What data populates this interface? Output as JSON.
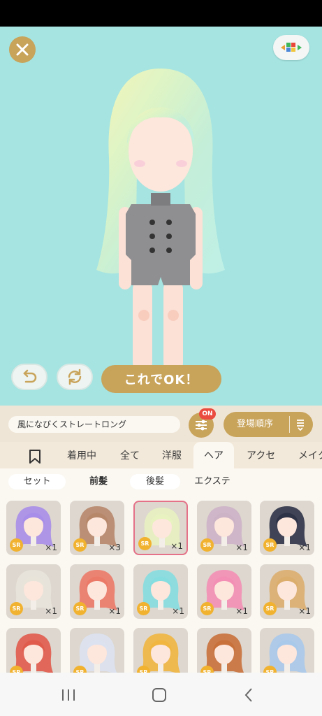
{
  "preview": {
    "ok_label": "これでOK！"
  },
  "controls": {
    "item_name": "風になびくストレートロング",
    "filter_badge": "ON",
    "sort_label": "登場順序"
  },
  "tabs": [
    "着用中",
    "全て",
    "洋服",
    "ヘア",
    "アクセ",
    "メイク"
  ],
  "active_tab": "ヘア",
  "subtabs": [
    "セット",
    "前髪",
    "後髪",
    "エクステ"
  ],
  "active_subtab": "前髪",
  "grid_items": [
    {
      "rarity": "SR",
      "qty": "×1",
      "hair_color": "#a88ee8"
    },
    {
      "rarity": "SR",
      "qty": "×3",
      "hair_color": "#b7876a"
    },
    {
      "rarity": "SR",
      "qty": "×1",
      "hair_color": "#e8f2c0",
      "selected": true
    },
    {
      "rarity": "SR",
      "qty": "×1",
      "hair_color": "#cdb3c6"
    },
    {
      "rarity": "SR",
      "qty": "×1",
      "hair_color": "#2f3347"
    },
    {
      "rarity": "SR",
      "qty": "×1",
      "hair_color": "#e9e4da"
    },
    {
      "rarity": "SR",
      "qty": "×1",
      "hair_color": "#ec7a68"
    },
    {
      "rarity": "SR",
      "qty": "×1",
      "hair_color": "#86dde0"
    },
    {
      "rarity": "SR",
      "qty": "×1",
      "hair_color": "#f38fb4"
    },
    {
      "rarity": "SR",
      "qty": "×1",
      "hair_color": "#dcae6e"
    },
    {
      "rarity": "SR",
      "qty": "",
      "hair_color": "#e05b4b"
    },
    {
      "rarity": "SR",
      "qty": "",
      "hair_color": "#dce2ef"
    },
    {
      "rarity": "SR",
      "qty": "",
      "hair_color": "#f0b640"
    },
    {
      "rarity": "SR",
      "qty": "",
      "hair_color": "#c9713b"
    },
    {
      "rarity": "SR",
      "qty": "",
      "hair_color": "#a9c9ea"
    }
  ],
  "colors": {
    "accent_gold": "#c8a35a",
    "stage_bg": "#a5e4e1",
    "selected_border": "#e47187",
    "badge_red": "#ea4b3e"
  }
}
